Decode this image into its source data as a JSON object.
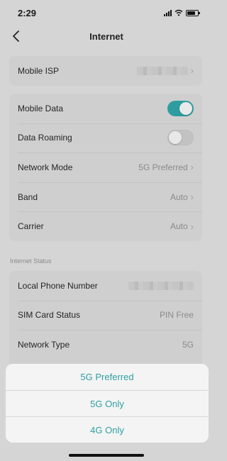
{
  "status_bar": {
    "time": "2:29"
  },
  "header": {
    "title": "Internet"
  },
  "isp_card": {
    "label": "Mobile ISP"
  },
  "settings": {
    "mobile_data": {
      "label": "Mobile Data",
      "enabled": true
    },
    "data_roaming": {
      "label": "Data Roaming",
      "enabled": false
    },
    "network_mode": {
      "label": "Network Mode",
      "value": "5G Preferred"
    },
    "band": {
      "label": "Band",
      "value": "Auto"
    },
    "carrier": {
      "label": "Carrier",
      "value": "Auto"
    }
  },
  "internet_status": {
    "section_title": "Internet Status",
    "local_phone_number": {
      "label": "Local Phone Number"
    },
    "sim_card_status": {
      "label": "SIM Card Status",
      "value": "PIN Free"
    },
    "network_type": {
      "label": "Network Type",
      "value": "5G"
    }
  },
  "action_sheet": {
    "options": [
      "5G Preferred",
      "5G Only",
      "4G Only"
    ]
  },
  "colors": {
    "accent": "#2e9da0",
    "overlay_background": "#d5d5d5",
    "sheet_background": "#f4f4f4"
  },
  "icons": {
    "back": "chevron-left-icon",
    "chevron": "chevron-right-icon",
    "signal": "cellular-signal-icon",
    "wifi": "wifi-icon",
    "battery": "battery-icon"
  }
}
